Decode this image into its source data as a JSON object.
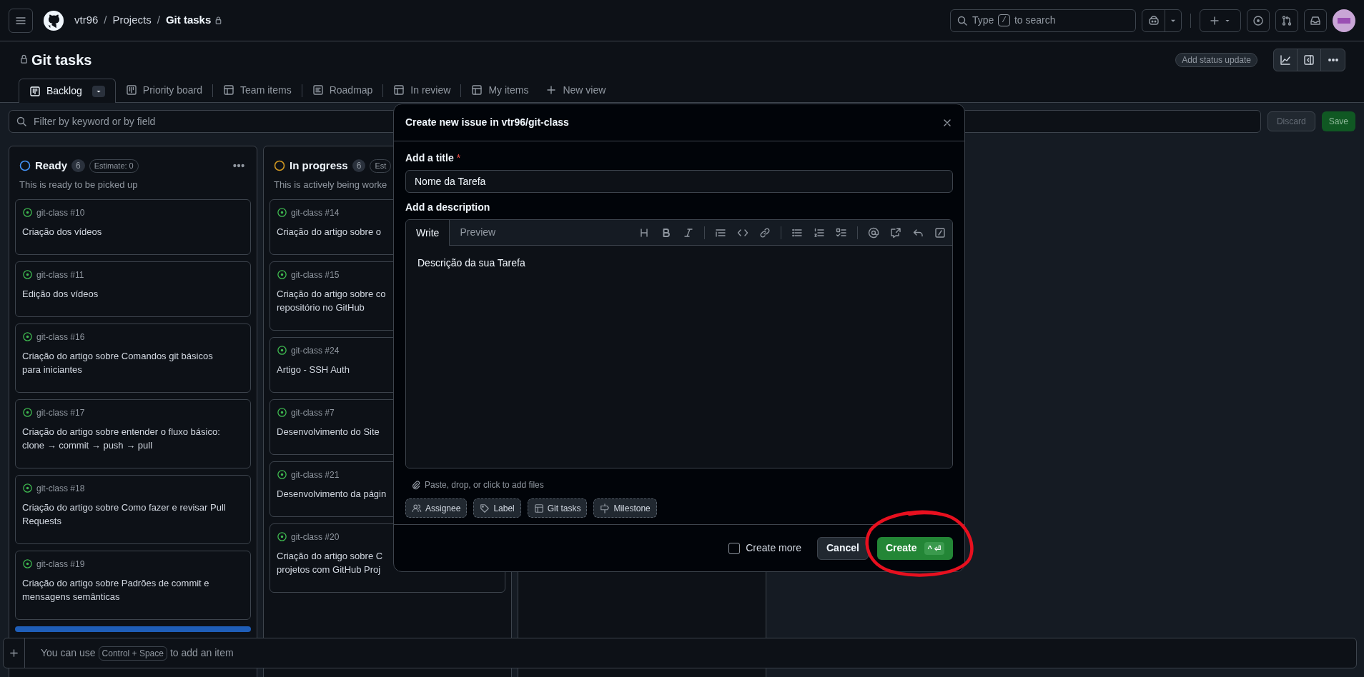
{
  "header": {
    "breadcrumbs": [
      "vtr96",
      "Projects",
      "Git tasks"
    ],
    "separator": "/",
    "search": {
      "placeholder_prefix": "Type",
      "shortcut": "/",
      "placeholder_suffix": "to search"
    }
  },
  "project": {
    "title": "Git tasks",
    "status_button": "Add status update"
  },
  "views": [
    {
      "label": "Backlog",
      "kind": "board",
      "selected": true
    },
    {
      "label": "Priority board",
      "kind": "board",
      "selected": false
    },
    {
      "label": "Team items",
      "kind": "table",
      "selected": false
    },
    {
      "label": "Roadmap",
      "kind": "roadmap",
      "selected": false
    },
    {
      "label": "In review",
      "kind": "table",
      "selected": false
    },
    {
      "label": "My items",
      "kind": "table",
      "selected": false
    }
  ],
  "new_view": "New view",
  "filter": {
    "placeholder": "Filter by keyword or by field",
    "discard": "Discard",
    "save": "Save"
  },
  "columns": [
    {
      "name": "Ready",
      "color": "#4493f8",
      "count": "6",
      "estimate": "Estimate: 0",
      "description": "This is ready to be picked up",
      "items": [
        {
          "ref": "git-class #10",
          "title": "Criação dos vídeos"
        },
        {
          "ref": "git-class #11",
          "title": "Edição dos vídeos"
        },
        {
          "ref": "git-class #16",
          "title": "Criação do artigo sobre Comandos git básicos\npara iniciantes"
        },
        {
          "ref": "git-class #17",
          "title": "Criação do artigo sobre entender o fluxo básico:\nclone → commit → push → pull"
        },
        {
          "ref": "git-class #18",
          "title": "Criação do artigo sobre Como fazer e revisar Pull\nRequests"
        },
        {
          "ref": "git-class #19",
          "title": "Criação do artigo sobre Padrões de commit e\nmensagens semânticas"
        }
      ]
    },
    {
      "name": "In progress",
      "color": "#d29922",
      "count": "6",
      "estimate": "Est",
      "description": "This is actively being worke",
      "items": [
        {
          "ref": "git-class #14",
          "title": "Criação do artigo sobre o"
        },
        {
          "ref": "git-class #15",
          "title": "Criação do artigo sobre co\nrepositório no GitHub"
        },
        {
          "ref": "git-class #24",
          "title": "Artigo - SSH Auth"
        },
        {
          "ref": "git-class #7",
          "title": "Desenvolvimento do Site"
        },
        {
          "ref": "git-class #21",
          "title": "Desenvolvimento da págin"
        },
        {
          "ref": "git-class #20",
          "title": "Criação do artigo sobre C\nprojetos com GitHub Proj"
        }
      ]
    }
  ],
  "dialog": {
    "title": "Create new issue in vtr96/git-class",
    "title_label": "Add a title",
    "required_mark": "*",
    "title_value": "Nome da Tarefa",
    "description_label": "Add a description",
    "editor_tabs": [
      {
        "label": "Write",
        "selected": true
      },
      {
        "label": "Preview",
        "selected": false
      }
    ],
    "description_value": "Descrição da sua Tarefa",
    "attach_hint": "Paste, drop, or click to add files",
    "chips": [
      {
        "label": "Assignee",
        "kind": "people"
      },
      {
        "label": "Label",
        "kind": "tag"
      },
      {
        "label": "Git tasks",
        "kind": "table"
      },
      {
        "label": "Milestone",
        "kind": "milestone"
      }
    ],
    "create_more": {
      "label": "Create more",
      "checked": false
    },
    "cancel": "Cancel",
    "create": "Create",
    "create_shortcut": "^ ⏎"
  },
  "add_item_bar": {
    "prefix": "You can use",
    "shortcut": "Control + Space",
    "suffix": "to add an item"
  }
}
